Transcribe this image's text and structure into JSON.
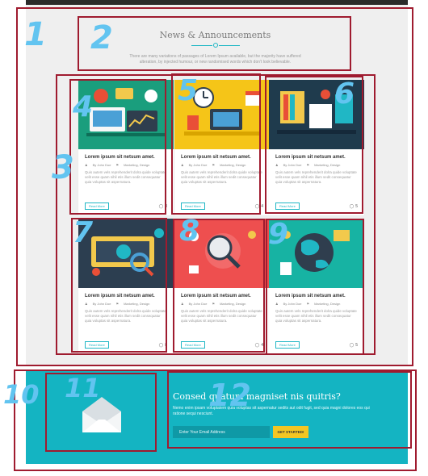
{
  "news": {
    "title": "News & Announcements",
    "subtitle": "There are many variations of passages of Lorem Ipsum available, but the majority have suffered alteration, by injected humour, or new randomised words which don't look believable."
  },
  "cards": [
    {
      "title": "Lorem ipsum sit netsum amet.",
      "author": "By John Doe",
      "category": "Marketing, Design",
      "text": "Quis autem vels reprehenderit dolra quide voluptate velit esse quam nihil etis illum sedit consequatur quia voluptas sit aspernatura.",
      "read_more": "Read More",
      "comments": "8"
    },
    {
      "title": "Lorem ipsum sit netsum amet.",
      "author": "By John Doe",
      "category": "Marketing, Design",
      "text": "Quis autem vels reprehenderit dolra quide voluptate velit esse quam nihil etis illum sedit consequatur quia voluptas sit aspernatura.",
      "read_more": "Read More",
      "comments": "4"
    },
    {
      "title": "Lorem ipsum sit netsum amet.",
      "author": "By John Doe",
      "category": "Marketing, Design",
      "text": "Quis autem vels reprehenderit dolra quide voluptate velit esse quam nihil etis illum sedit consequatur quia voluptas sit aspernatura.",
      "read_more": "Read More",
      "comments": "5"
    },
    {
      "title": "Lorem ipsum sit netsum amet.",
      "author": "By John Doe",
      "category": "Marketing, Design",
      "text": "Quis autem vels reprehenderit dolra quide voluptate velit esse quam nihil etis illum sedit consequatur quia voluptas sit aspernatura.",
      "read_more": "Read More",
      "comments": "8"
    },
    {
      "title": "Lorem ipsum sit netsum amet.",
      "author": "By John Doe",
      "category": "Marketing, Design",
      "text": "Quis autem vels reprehenderit dolra quide voluptate velit esse quam nihil etis illum sedit consequatur quia voluptas sit aspernatura.",
      "read_more": "Read More",
      "comments": "4"
    },
    {
      "title": "Lorem ipsum sit netsum amet.",
      "author": "By John Doe",
      "category": "Marketing, Design",
      "text": "Quis autem vels reprehenderit dolra quide voluptate velit esse quam nihil etis illum sedit consequatur quia voluptas sit aspernatura.",
      "read_more": "Read More",
      "comments": "5"
    }
  ],
  "subscribe": {
    "title": "Consed quatum magniset nis quitris?",
    "text": "Nemo enim ipsam voluptatem quia voluptas sit aspernatur sedits aut odit fugit, sed quia magni dolores eos qui ratione sequi nesciunt.",
    "email_placeholder": "Enter Your Email Address",
    "button_label": "GET STARTED!"
  },
  "annotations": {
    "tags": [
      "1",
      "2",
      "3",
      "4",
      "5",
      "6",
      "7",
      "8",
      "9",
      "10",
      "11",
      "12"
    ]
  },
  "colors": {
    "accent": "#20b7c5",
    "subscribe_bg": "#14b4c2",
    "cta": "#f3c623",
    "annotation_box": "#9f1b2f",
    "annotation_label": "#62c4f0"
  },
  "icons": {
    "author": "user-icon",
    "category": "tag-icon",
    "comments": "comment-icon",
    "subscribe": "envelope-icon"
  }
}
